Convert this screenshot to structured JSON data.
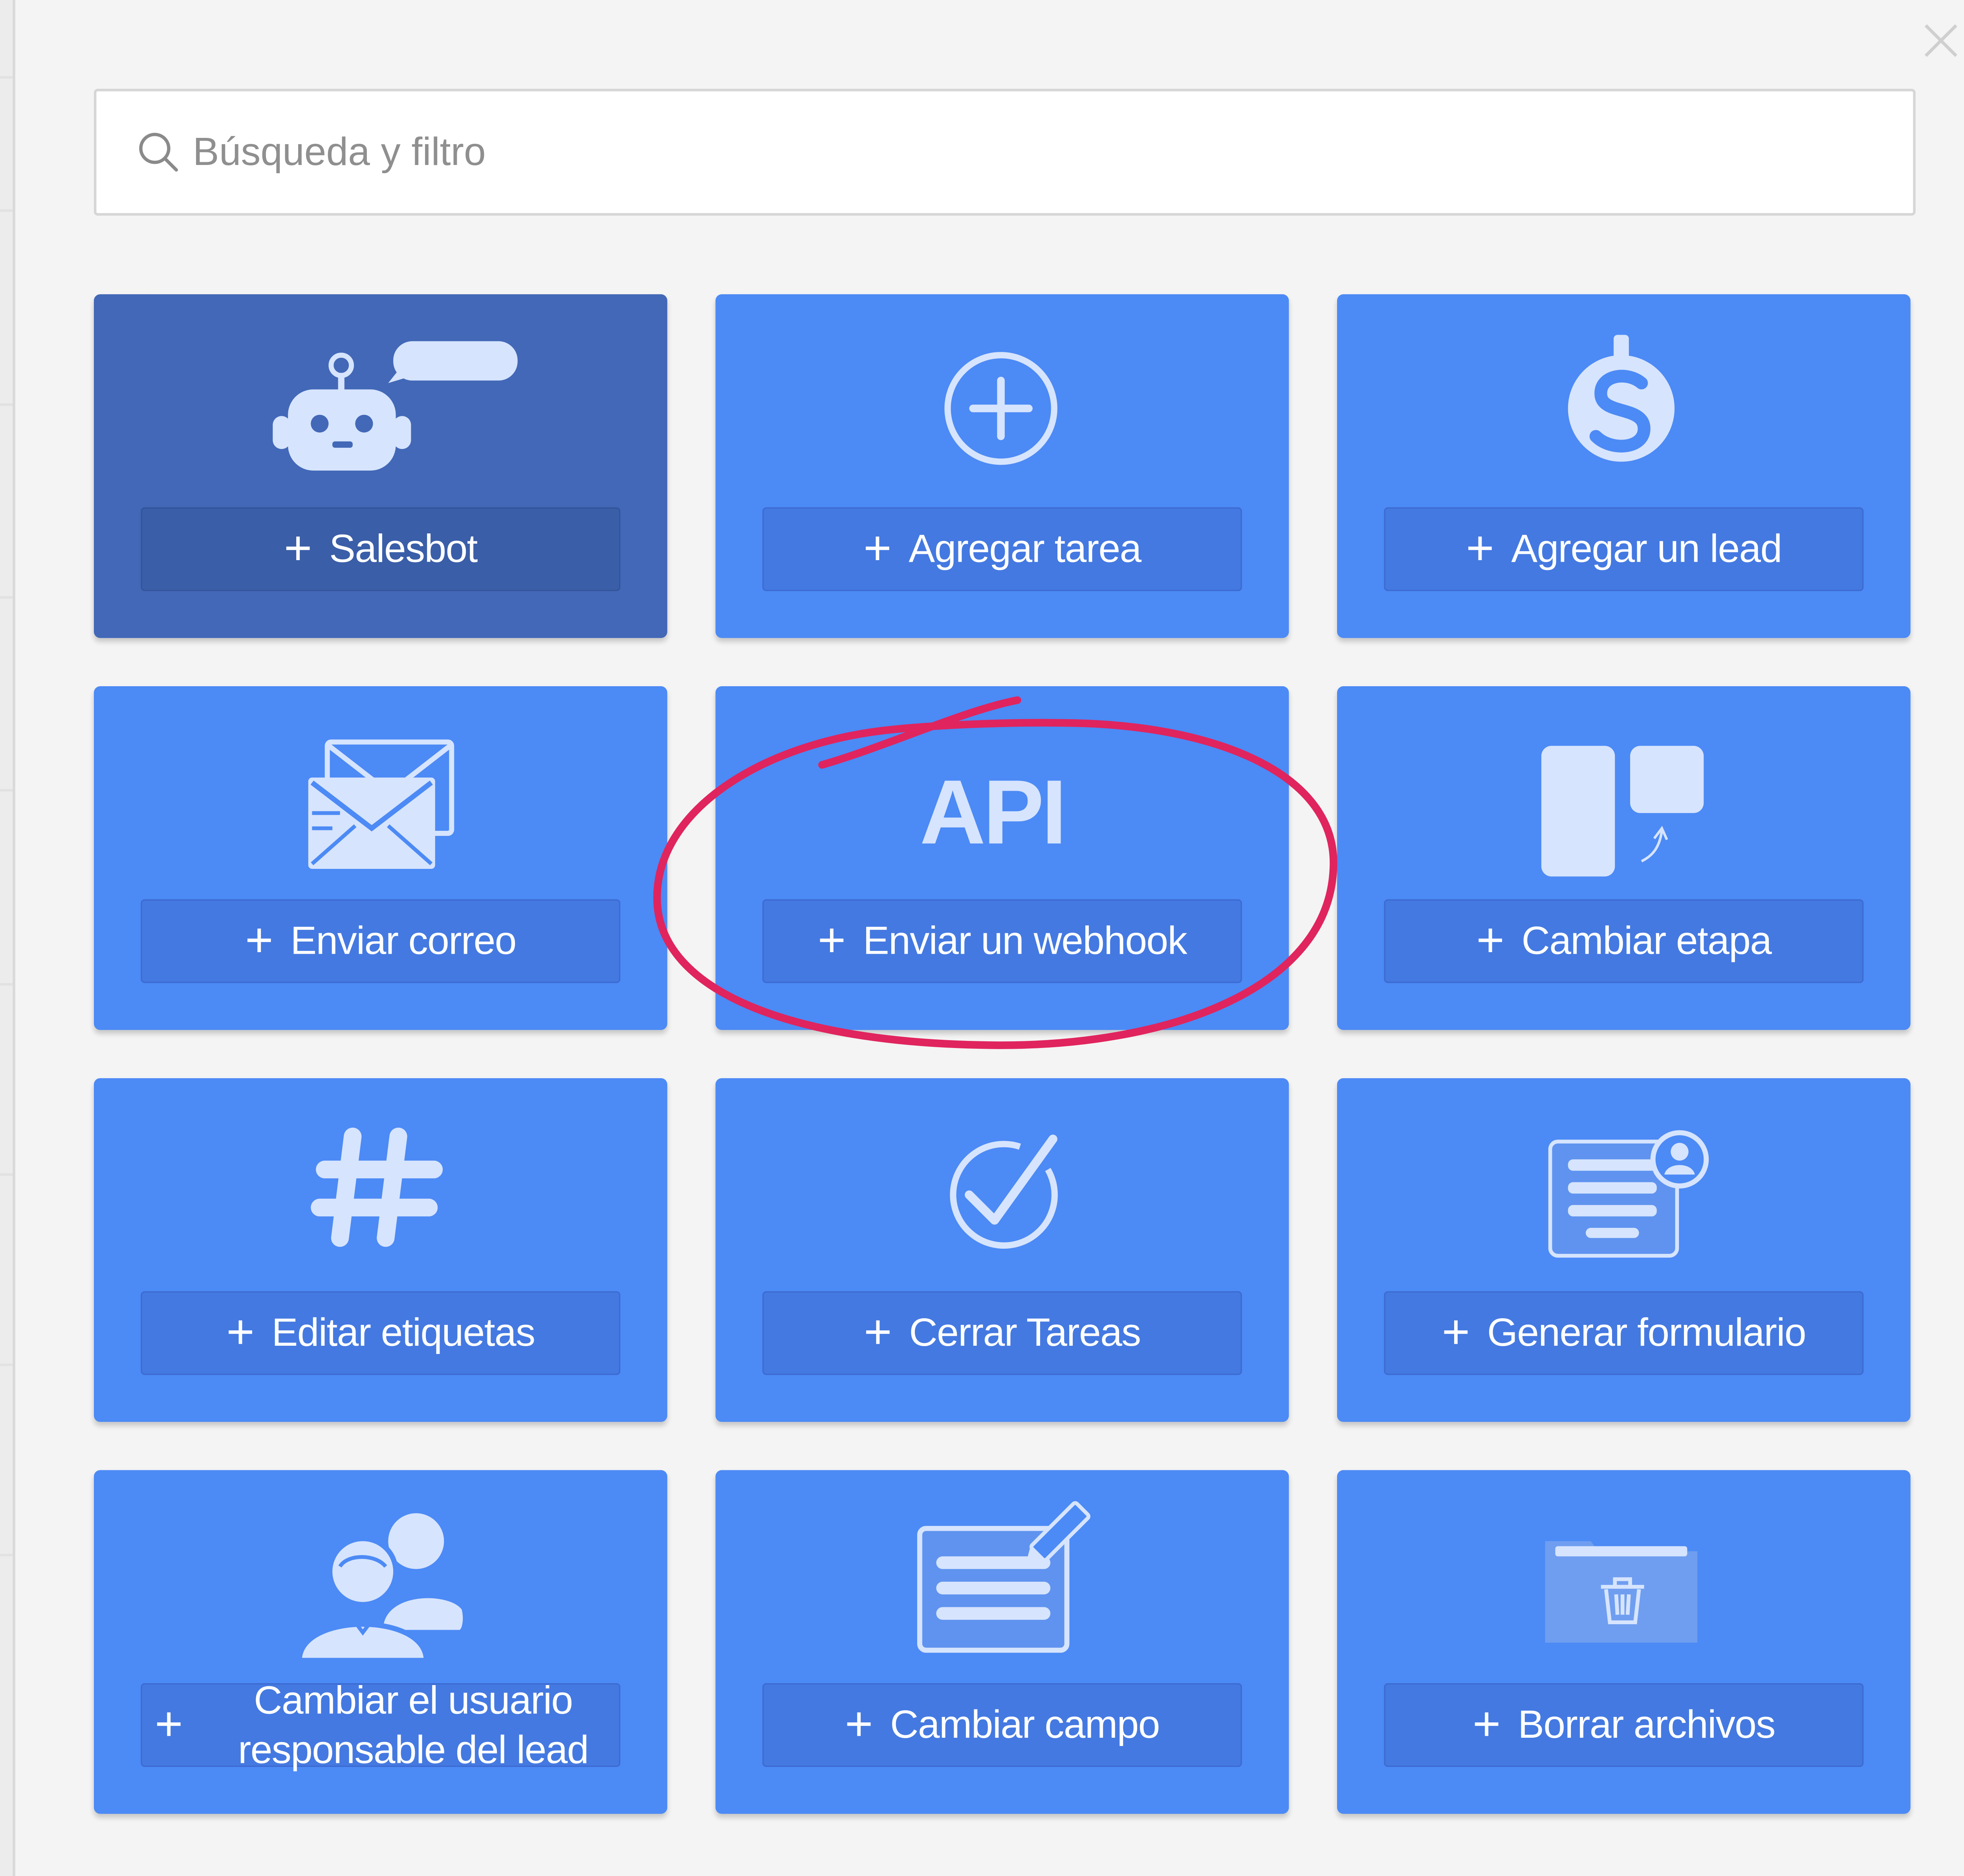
{
  "search": {
    "placeholder": "Búsqueda y filtro"
  },
  "actions": [
    {
      "label": "Salesbot",
      "icon": "robot-icon",
      "selected": true
    },
    {
      "label": "Agregar tarea",
      "icon": "plus-circle-icon",
      "selected": false
    },
    {
      "label": "Agregar un lead",
      "icon": "dollar-icon",
      "selected": false
    },
    {
      "label": "Enviar correo",
      "icon": "envelope-icon",
      "selected": false
    },
    {
      "label": "Enviar un webhook",
      "icon": "api-icon",
      "icon_text": "API",
      "selected": false,
      "highlighted": true
    },
    {
      "label": "Cambiar etapa",
      "icon": "stage-icon",
      "selected": false
    },
    {
      "label": "Editar etiquetas",
      "icon": "hashtag-icon",
      "selected": false
    },
    {
      "label": "Cerrar Tareas",
      "icon": "check-circle-icon",
      "selected": false
    },
    {
      "label": "Generar formulario",
      "icon": "form-icon",
      "selected": false
    },
    {
      "label": "Cambiar el usuario responsable del lead",
      "icon": "users-icon",
      "selected": false
    },
    {
      "label": "Cambiar campo",
      "icon": "edit-field-icon",
      "selected": false
    },
    {
      "label": "Borrar archivos",
      "icon": "folder-trash-icon",
      "selected": false
    }
  ],
  "colors": {
    "card": "#4c8af5",
    "card_selected": "#4268b7",
    "button": "#4479e1",
    "icon_light": "#d6e4fd",
    "annotation": "#e0245e"
  }
}
